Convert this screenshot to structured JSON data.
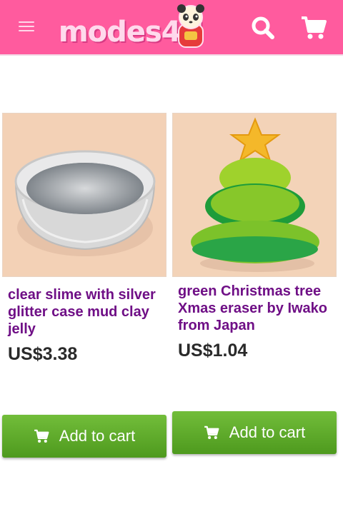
{
  "header": {
    "brand": "modes4U",
    "menu_icon": "hamburger-menu-icon",
    "search_icon": "search-icon",
    "cart_icon": "cart-icon",
    "background_color": "#ff5b9e"
  },
  "products": [
    {
      "title": "clear slime with silver glitter case mud clay jelly",
      "price": "US$3.38",
      "button_label": "Add to cart"
    },
    {
      "title": "green Christmas tree Xmas eraser by Iwako from Japan",
      "price": "US$1.04",
      "button_label": "Add to cart"
    }
  ],
  "colors": {
    "title": "#6f0f86",
    "button": "#5aa826"
  }
}
